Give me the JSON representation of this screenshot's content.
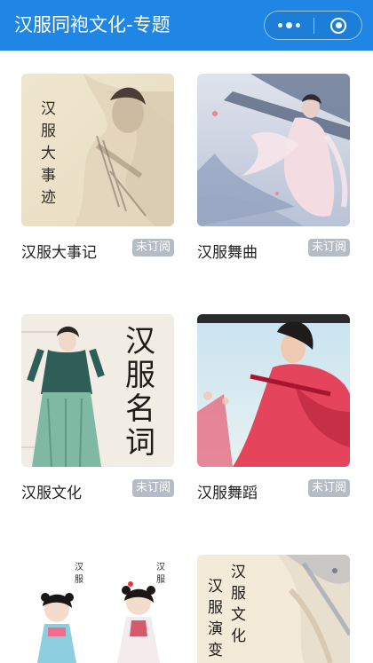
{
  "navbar": {
    "title": "汉服同袍文化-专题",
    "color": "#1f86e6",
    "more_icon": "more-dots-icon",
    "close_icon": "target-close-icon"
  },
  "topics": [
    {
      "title": "汉服大事记",
      "badge": "未订阅",
      "image_text": "汉服大事迹"
    },
    {
      "title": "汉服舞曲",
      "badge": "未订阅"
    },
    {
      "title": "汉服文化",
      "badge": "未订阅",
      "image_text": "汉服名词"
    },
    {
      "title": "汉服舞蹈",
      "badge": "未订阅"
    },
    {
      "image_text_1": "汉服",
      "image_text_2": "汉服"
    },
    {
      "image_text_1": "汉服演变",
      "image_text_2": "汉服文化"
    }
  ]
}
